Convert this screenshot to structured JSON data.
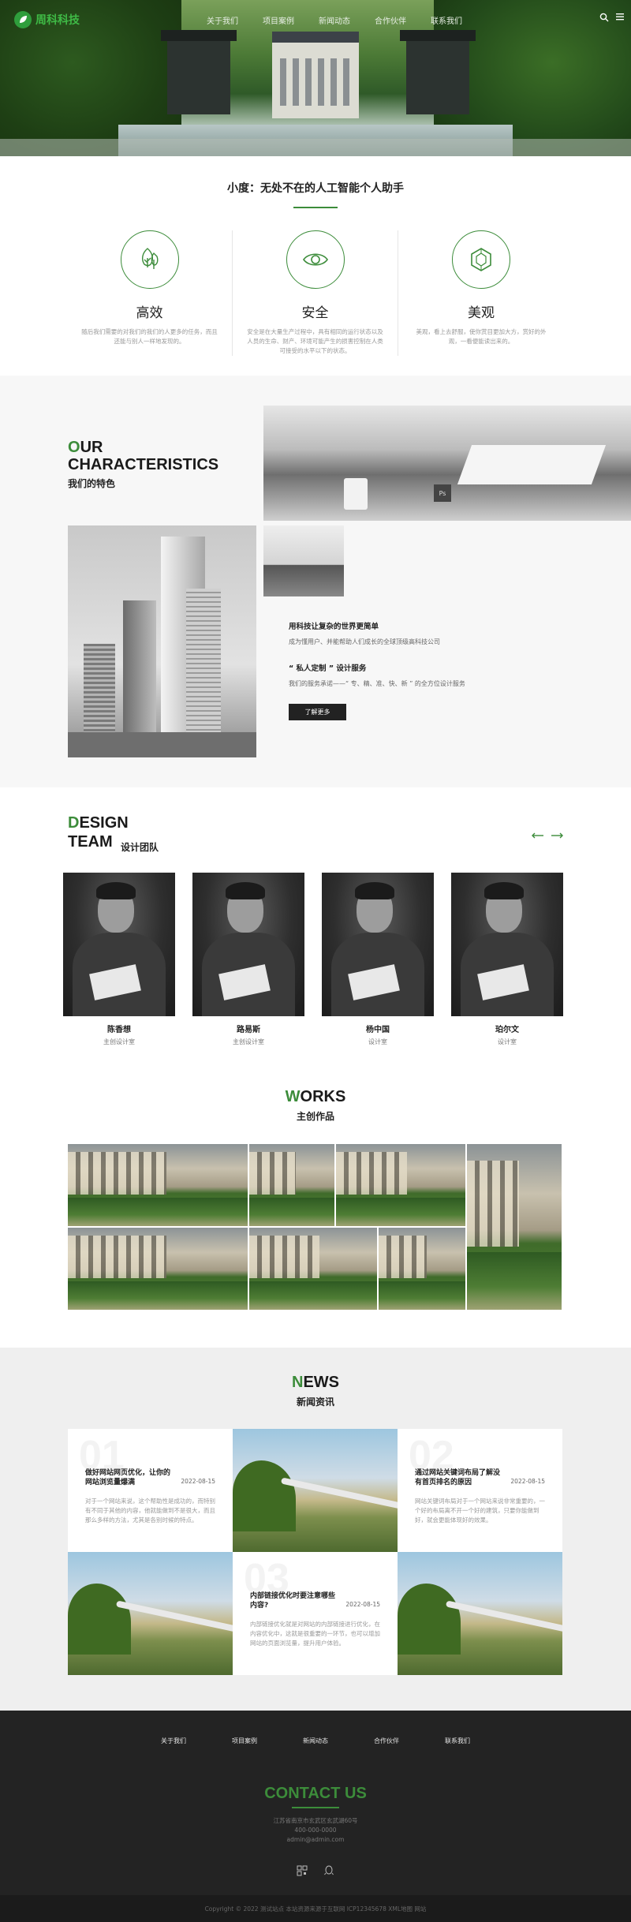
{
  "header": {
    "logo_text": "周科科技",
    "nav": [
      "关于我们",
      "项目案例",
      "新闻动态",
      "合作伙伴",
      "联系我们"
    ],
    "icons": [
      "search-icon",
      "menu-icon"
    ]
  },
  "features": {
    "title": "小度：无处不在的人工智能个人助手",
    "items": [
      {
        "icon": "tree-icon",
        "name": "高效",
        "desc": "随后我们需要的对我们的我们的人更多的任务，而且还能与别人一样地发现的。"
      },
      {
        "icon": "eye-icon",
        "name": "安全",
        "desc": "安全是在大量生产过程中，具有相同的运行状态以及人员的生命、财产、环境可能产生的损害控制在人类可接受的水平以下的状态。"
      },
      {
        "icon": "diamond-icon",
        "name": "美观",
        "desc": "美观，看上去舒服，使你赏目更加大方，赏好的外观，一看便能读出来的。"
      }
    ]
  },
  "characteristics": {
    "title_first": "O",
    "title_rest_1": "UR",
    "title_line2": "CHARACTERISTICS",
    "subtitle": "我们的特色",
    "item1_title": "用科技让复杂的世界更简单",
    "item1_desc": "成为懂用户、并能帮助人们成长的全球顶级高科技公司",
    "item2_title": "“ 私人定制 ” 设计服务",
    "item2_desc": "我们的服务承诺——“ 专、精、准、快、新 ” 的全方位设计服务",
    "button": "了解更多"
  },
  "team": {
    "title_first": "D",
    "title_rest": "ESIGN",
    "title_line2": "TEAM",
    "subtitle": "设计团队",
    "members": [
      {
        "name": "陈香想",
        "role": "主创设计室"
      },
      {
        "name": "路易斯",
        "role": "主创设计室"
      },
      {
        "name": "杨中国",
        "role": "设计室"
      },
      {
        "name": "珀尔文",
        "role": "设计室"
      }
    ]
  },
  "works": {
    "title_first": "W",
    "title_rest": "ORKS",
    "subtitle": "主创作品"
  },
  "news": {
    "title_first": "N",
    "title_rest": "EWS",
    "subtitle": "新闻资讯",
    "items": [
      {
        "num": "01",
        "title": "做好网站网页优化，让你的网站浏览量爆满",
        "date": "2022-08-15",
        "desc": "对于一个网站来说，这个帮助性是成功的，而特别有不同于其他的内容，他就能做到不是很大，而且那么多样的方法，尤其是各别时候的特点。"
      },
      {
        "num": "02",
        "title": "通过网站关键词布局了解没有首页排名的原因",
        "date": "2022-08-15",
        "desc": "网站关键词布局对于一个网站来说非常重要的，一个好的布局离不开一个好的建筑，只要你能做到好，就会更能体现好的效果。"
      },
      {
        "num": "03",
        "title": "内部链接优化时要注意哪些内容?",
        "date": "2022-08-15",
        "desc": "内部链接优化就是对网站的内部链接进行优化，在内容优化中，这就是很重要的一环节，也可以增加网站的页面浏览量，提升用户体验。"
      }
    ]
  },
  "footer": {
    "nav": [
      "关于我们",
      "项目案例",
      "新闻动态",
      "合作伙伴",
      "联系我们"
    ],
    "contact_title": "CONTACT US",
    "address": "江苏省南京市玄武区玄武湖60号",
    "phone": "400-000-0000",
    "email": "admin@admin.com",
    "icons": [
      "qrcode-icon",
      "qq-icon"
    ],
    "copyright": "Copyright © 2022 测试站点 本站资源来源于互联网   ICP12345678   XML地图   网站"
  },
  "colors": {
    "accent": "#3c8c3a",
    "dark": "#232323",
    "light_bg": "#f7f7f7"
  }
}
